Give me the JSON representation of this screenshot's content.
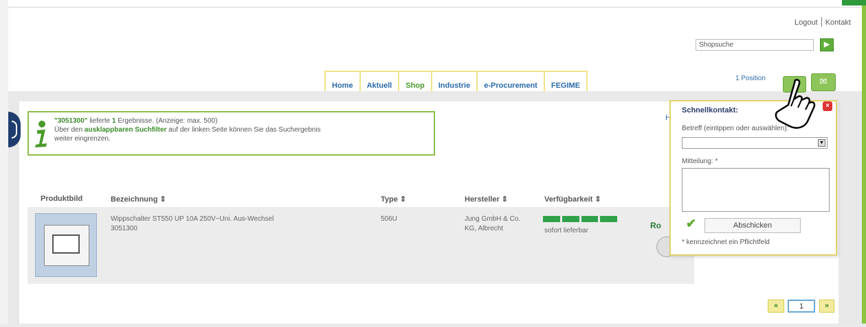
{
  "header": {
    "logout": "Logout",
    "kontakt": "Kontakt",
    "search_value": "Shopsuche",
    "go_icon": "arrow-right-icon",
    "position_text": "1 Position",
    "search_icon": "magnifier-icon",
    "mail_icon": "mail-icon"
  },
  "nav": {
    "tabs": [
      {
        "label": "Home"
      },
      {
        "label": "Aktuell"
      },
      {
        "label": "Shop"
      },
      {
        "label": "Industrie"
      },
      {
        "label": "e-Procurement"
      },
      {
        "label": "FEGIME"
      }
    ],
    "active_tab": "Shop"
  },
  "info": {
    "query": "\"3051300\"",
    "text1": " lieferte ",
    "count": "1",
    "text2": " Ergebnisse. (Anzeige: max. 500)",
    "line2a": "Über den ",
    "line2_link": "ausklappbaren Suchfilter",
    "line2b": " auf der linken Seite können Sie das Suchergebnis",
    "line3": "weiter eingrenzen."
  },
  "table": {
    "headers": {
      "image": "Produktbild",
      "name": "Bezeichnung ⇕",
      "type": "Type ⇕",
      "maker": "Hersteller ⇕",
      "avail": "Verfügbarkeit ⇕"
    },
    "rows": [
      {
        "name_line1": "Wippschalter ST550 UP 10A 250V~Uni. Aus-Wechsel",
        "name_line2": "3051300",
        "type": "506U",
        "maker_line1": "Jung GmbH & Co.",
        "maker_line2": "KG, Albrecht",
        "availability_level": 1.0,
        "availability_text": "sofort lieferbar",
        "ro_label": "Ro"
      }
    ]
  },
  "popup": {
    "title": "Schnellkontakt:",
    "close": "×",
    "subject_label": "Betreff (eintippen oder auswählen):",
    "subject_value": "",
    "message_label": "Mitteilung: *",
    "message_value": "",
    "send_label": "Abschicken",
    "note": "* kennzeichnet ein Pflichtfeld",
    "h_fragment": "H"
  },
  "pagination": {
    "prev": "«",
    "current": "1",
    "next": "»"
  },
  "colors": {
    "accent_green": "#8bc53f",
    "link_blue": "#2a6aa8",
    "availability_green": "#2fa24a"
  }
}
